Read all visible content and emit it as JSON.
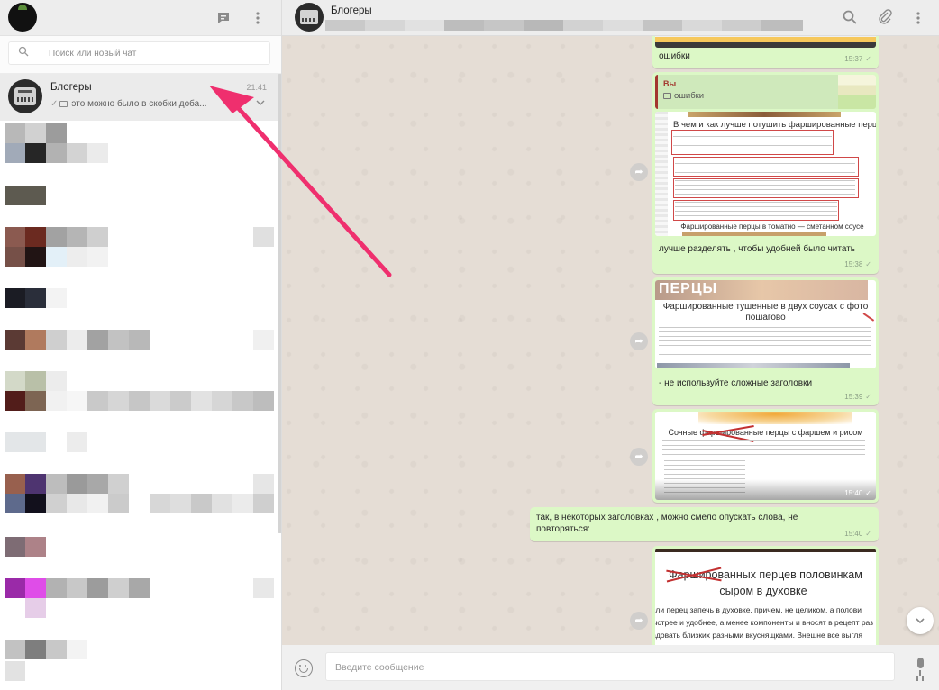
{
  "sidebar": {
    "header_icons": [
      "new-chat-icon",
      "menu-dots-icon"
    ],
    "search": {
      "placeholder": "Поиск или новый чат"
    },
    "active_chat": {
      "name": "Блогеры",
      "time": "21:41",
      "preview": "это можно было в скобки доба..."
    }
  },
  "conversation": {
    "title": "Блогеры",
    "header_icons": [
      "search-icon",
      "attach-icon",
      "menu-dots-icon"
    ],
    "messages": [
      {
        "text": "ошибки",
        "time": "15:37"
      },
      {
        "quote_author": "Вы",
        "quote_text": "ошибки"
      },
      {
        "image_title": "В чем и как лучше потушить фаршированные перцы",
        "image_caption": "Фаршированные перцы в томатно — сметанном соусе",
        "text": "лучше разделять , чтобы удобней было читать",
        "time": "15:38"
      },
      {
        "image_title": "Фаршированные тушенные в двух соусах с фото пошагово",
        "image_overlay": "ПЕРЦЫ",
        "text": "- не используйте сложные заголовки",
        "time": "15:39"
      },
      {
        "image_title": "Сочные фаршированные перцы с фаршем и рисом",
        "time": "15:40"
      },
      {
        "text": "так, в некоторых заголовках , можно смело опускать слова, не повторяться:",
        "time": "15:40"
      },
      {
        "image_title_line1": "Фаршированных перцев половинкам",
        "image_title_line2": "сыром в духовке",
        "image_body_line1": "... если перец запечь в духовке, причем, не целиком, а полови",
        "image_body_line2": "... быстрее и удобнее, а менее компоненты и вносят в рецепт раз",
        "image_body_line3": "... радовать близких разными вкуснящками. Внешне все выгля"
      }
    ],
    "composer": {
      "placeholder": "Введите сообщение"
    }
  },
  "colors": {
    "outgoing_bubble": "#dcf8c6",
    "chat_background": "#e5ddd5",
    "annotation_arrow": "#ef2f6e",
    "quote_accent": "#a3372f"
  }
}
